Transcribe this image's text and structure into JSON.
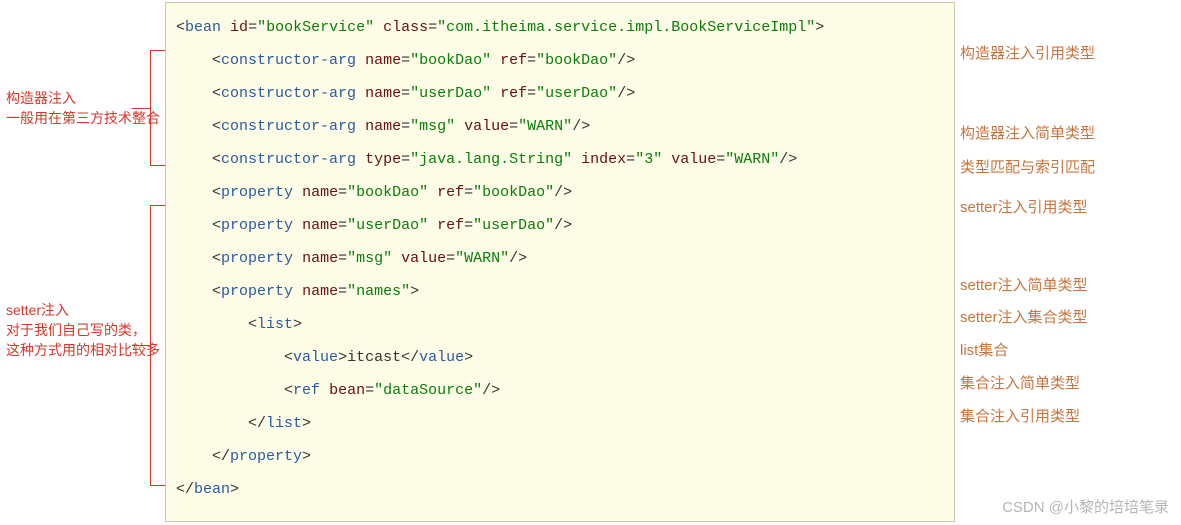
{
  "left_notes": {
    "n1a": "构造器注入",
    "n1b": "一般用在第三方技术整合",
    "n2a": "setter注入",
    "n2b": "  对于我们自己写的类，",
    "n2c": "这种方式用的相对比较多"
  },
  "right_notes": {
    "r1": "构造器注入引用类型",
    "r2": "构造器注入简单类型",
    "r3": "类型匹配与索引匹配",
    "r4": "setter注入引用类型",
    "r5": "setter注入简单类型",
    "r6": "setter注入集合类型",
    "r7": "list集合",
    "r8": "集合注入简单类型",
    "r9": "集合注入引用类型"
  },
  "code": {
    "bean_tag": "bean",
    "bean_id_attr": "id",
    "bean_id_val": "\"bookService\"",
    "bean_class_attr": "class",
    "bean_class_val": "\"com.itheima.service.impl.BookServiceImpl\"",
    "ctor_tag": "constructor-arg",
    "prop_tag": "property",
    "name_attr": "name",
    "ref_attr": "ref",
    "value_attr": "value",
    "type_attr": "type",
    "index_attr": "index",
    "bean_attr": "bean",
    "list_tag": "list",
    "value_tag": "value",
    "ref_tag": "ref",
    "bookDao": "\"bookDao\"",
    "userDao": "\"userDao\"",
    "msg": "\"msg\"",
    "warn": "\"WARN\"",
    "javaString": "\"java.lang.String\"",
    "idx3": "\"3\"",
    "names": "\"names\"",
    "itcast": "itcast",
    "dataSource": "\"dataSource\""
  },
  "watermark": "CSDN @小黎的培培笔录"
}
